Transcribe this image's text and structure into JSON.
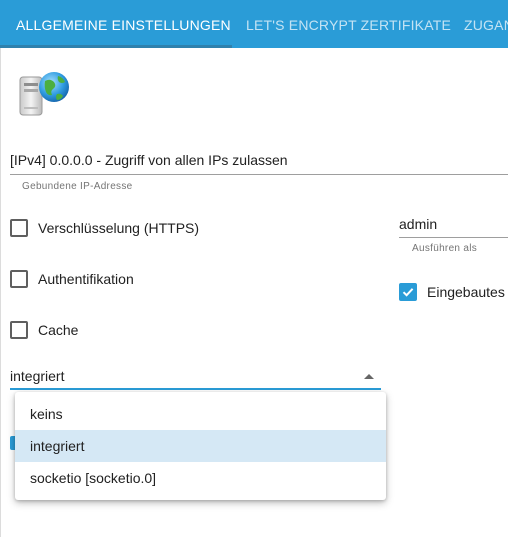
{
  "tabs": [
    {
      "label": "ALLGEMEINE EINSTELLUNGEN",
      "active": true
    },
    {
      "label": "LET'S ENCRYPT ZERTIFIKATE",
      "active": false
    },
    {
      "label": "ZUGANGSKONTROLLE",
      "active": false
    }
  ],
  "logo_icon": "server-globe-icon",
  "ip_field": {
    "value": "[IPv4] 0.0.0.0 - Zugriff von allen IPs zulassen",
    "helper": "Gebundene IP-Adresse"
  },
  "run_as_field": {
    "value": "admin",
    "helper": "Ausführen als"
  },
  "checkboxes": {
    "https": {
      "label": "Verschlüsselung (HTTPS)",
      "checked": false
    },
    "auth": {
      "label": "Authentifikation",
      "checked": false
    },
    "cache": {
      "label": "Cache",
      "checked": false
    },
    "builtin": {
      "label": "Eingebautes",
      "checked": true
    }
  },
  "socket_select": {
    "value": "integriert",
    "options": [
      {
        "label": "keins",
        "selected": false
      },
      {
        "label": "integriert",
        "selected": true
      },
      {
        "label": "socketio [socketio.0]",
        "selected": false
      }
    ]
  },
  "colors": {
    "accent": "#2a9cd7",
    "menu_selected": "#d5e8f5"
  }
}
